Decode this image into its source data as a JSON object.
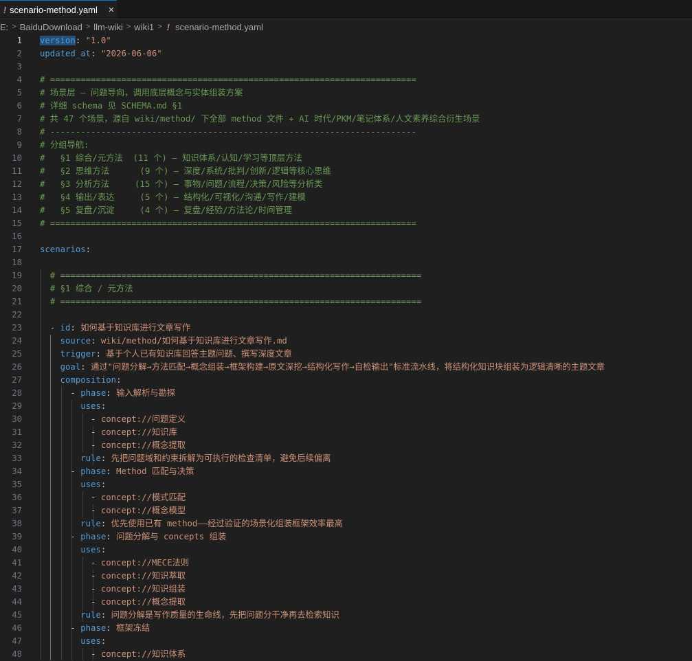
{
  "tab": {
    "title": "scenario-method.yaml",
    "close_label": "×"
  },
  "breadcrumb": [
    "E:",
    "BaiduDownload",
    "llm-wiki",
    "wiki1",
    "scenario-method.yaml"
  ],
  "editor": {
    "current_line": 1,
    "lines": [
      [
        [
          "k",
          "version"
        ],
        [
          "p",
          ": "
        ],
        [
          "v",
          "\"1.0\""
        ]
      ],
      [
        [
          "k",
          "updated_at"
        ],
        [
          "p",
          ": "
        ],
        [
          "v",
          "\"2026-06-06\""
        ]
      ],
      [],
      [
        [
          "c",
          "# ========================================================================"
        ]
      ],
      [
        [
          "c",
          "# 场景层 — 问题导向，调用底层概念与实体组装方案"
        ]
      ],
      [
        [
          "c",
          "# 详细 schema 见 SCHEMA.md §1"
        ]
      ],
      [
        [
          "c",
          "# 共 47 个场景，源自 wiki/method/ 下全部 method 文件 + AI 时代/PKM/笔记体系/人文素养综合衍生场景"
        ]
      ],
      [
        [
          "c",
          "# ------------------------------------------------------------------------"
        ]
      ],
      [
        [
          "c",
          "# 分组导航:"
        ]
      ],
      [
        [
          "c",
          "#   §1 综合/元方法  (11 个) — 知识体系/认知/学习等顶层方法"
        ]
      ],
      [
        [
          "c",
          "#   §2 思维方法      (9 个) — 深度/系统/批判/创新/逻辑等核心思维"
        ]
      ],
      [
        [
          "c",
          "#   §3 分析方法     (15 个) — 事物/问题/流程/决策/风险等分析类"
        ]
      ],
      [
        [
          "c",
          "#   §4 输出/表达     (5 个) — 结构化/可视化/沟通/写作/建模"
        ]
      ],
      [
        [
          "c",
          "#   §5 复盘/沉淀     (4 个) — 复盘/经验/方法论/时间管理"
        ]
      ],
      [
        [
          "c",
          "# ========================================================================"
        ]
      ],
      [],
      [
        [
          "k",
          "scenarios"
        ],
        [
          "p",
          ":"
        ]
      ],
      [],
      [
        [
          "p",
          "  "
        ],
        [
          "c",
          "# ======================================================================="
        ]
      ],
      [
        [
          "p",
          "  "
        ],
        [
          "c",
          "# §1 综合 / 元方法"
        ]
      ],
      [
        [
          "p",
          "  "
        ],
        [
          "c",
          "# ======================================================================="
        ]
      ],
      [],
      [
        [
          "p",
          "  - "
        ],
        [
          "k",
          "id"
        ],
        [
          "p",
          ": "
        ],
        [
          "v",
          "如何基于知识库进行文章写作"
        ]
      ],
      [
        [
          "p",
          "    "
        ],
        [
          "k",
          "source"
        ],
        [
          "p",
          ": "
        ],
        [
          "v",
          "wiki/method/如何基于知识库进行文章写作.md"
        ]
      ],
      [
        [
          "p",
          "    "
        ],
        [
          "k",
          "trigger"
        ],
        [
          "p",
          ": "
        ],
        [
          "v",
          "基于个人已有知识库回答主题问题、撰写深度文章"
        ]
      ],
      [
        [
          "p",
          "    "
        ],
        [
          "k",
          "goal"
        ],
        [
          "p",
          ": "
        ],
        [
          "v",
          "通过\"问题分解→方法匹配→概念组装→框架构建→原文深挖→结构化写作→自检输出\"标准流水线，将结构化知识块组装为逻辑清晰的主题文章"
        ]
      ],
      [
        [
          "p",
          "    "
        ],
        [
          "k",
          "composition"
        ],
        [
          "p",
          ":"
        ]
      ],
      [
        [
          "p",
          "      - "
        ],
        [
          "k",
          "phase"
        ],
        [
          "p",
          ": "
        ],
        [
          "v",
          "输入解析与勘探"
        ]
      ],
      [
        [
          "p",
          "        "
        ],
        [
          "k",
          "uses"
        ],
        [
          "p",
          ":"
        ]
      ],
      [
        [
          "p",
          "          - "
        ],
        [
          "v",
          "concept://问题定义"
        ]
      ],
      [
        [
          "p",
          "          - "
        ],
        [
          "v",
          "concept://知识库"
        ]
      ],
      [
        [
          "p",
          "          - "
        ],
        [
          "v",
          "concept://概念提取"
        ]
      ],
      [
        [
          "p",
          "        "
        ],
        [
          "k",
          "rule"
        ],
        [
          "p",
          ": "
        ],
        [
          "v",
          "先把问题域和约束拆解为可执行的检查清单，避免后续偏离"
        ]
      ],
      [
        [
          "p",
          "      - "
        ],
        [
          "k",
          "phase"
        ],
        [
          "p",
          ": "
        ],
        [
          "v",
          "Method 匹配与决策"
        ]
      ],
      [
        [
          "p",
          "        "
        ],
        [
          "k",
          "uses"
        ],
        [
          "p",
          ":"
        ]
      ],
      [
        [
          "p",
          "          - "
        ],
        [
          "v",
          "concept://模式匹配"
        ]
      ],
      [
        [
          "p",
          "          - "
        ],
        [
          "v",
          "concept://概念模型"
        ]
      ],
      [
        [
          "p",
          "        "
        ],
        [
          "k",
          "rule"
        ],
        [
          "p",
          ": "
        ],
        [
          "v",
          "优先使用已有 method——经过验证的场景化组装框架效率最高"
        ]
      ],
      [
        [
          "p",
          "      - "
        ],
        [
          "k",
          "phase"
        ],
        [
          "p",
          ": "
        ],
        [
          "v",
          "问题分解与 concepts 组装"
        ]
      ],
      [
        [
          "p",
          "        "
        ],
        [
          "k",
          "uses"
        ],
        [
          "p",
          ":"
        ]
      ],
      [
        [
          "p",
          "          - "
        ],
        [
          "v",
          "concept://MECE法则"
        ]
      ],
      [
        [
          "p",
          "          - "
        ],
        [
          "v",
          "concept://知识萃取"
        ]
      ],
      [
        [
          "p",
          "          - "
        ],
        [
          "v",
          "concept://知识组装"
        ]
      ],
      [
        [
          "p",
          "          - "
        ],
        [
          "v",
          "concept://概念提取"
        ]
      ],
      [
        [
          "p",
          "        "
        ],
        [
          "k",
          "rule"
        ],
        [
          "p",
          ": "
        ],
        [
          "v",
          "问题分解是写作质量的生命线，先把问题分干净再去检索知识"
        ]
      ],
      [
        [
          "p",
          "      - "
        ],
        [
          "k",
          "phase"
        ],
        [
          "p",
          ": "
        ],
        [
          "v",
          "框架冻结"
        ]
      ],
      [
        [
          "p",
          "        "
        ],
        [
          "k",
          "uses"
        ],
        [
          "p",
          ":"
        ]
      ],
      [
        [
          "p",
          "          - "
        ],
        [
          "v",
          "concept://知识体系"
        ]
      ]
    ]
  }
}
